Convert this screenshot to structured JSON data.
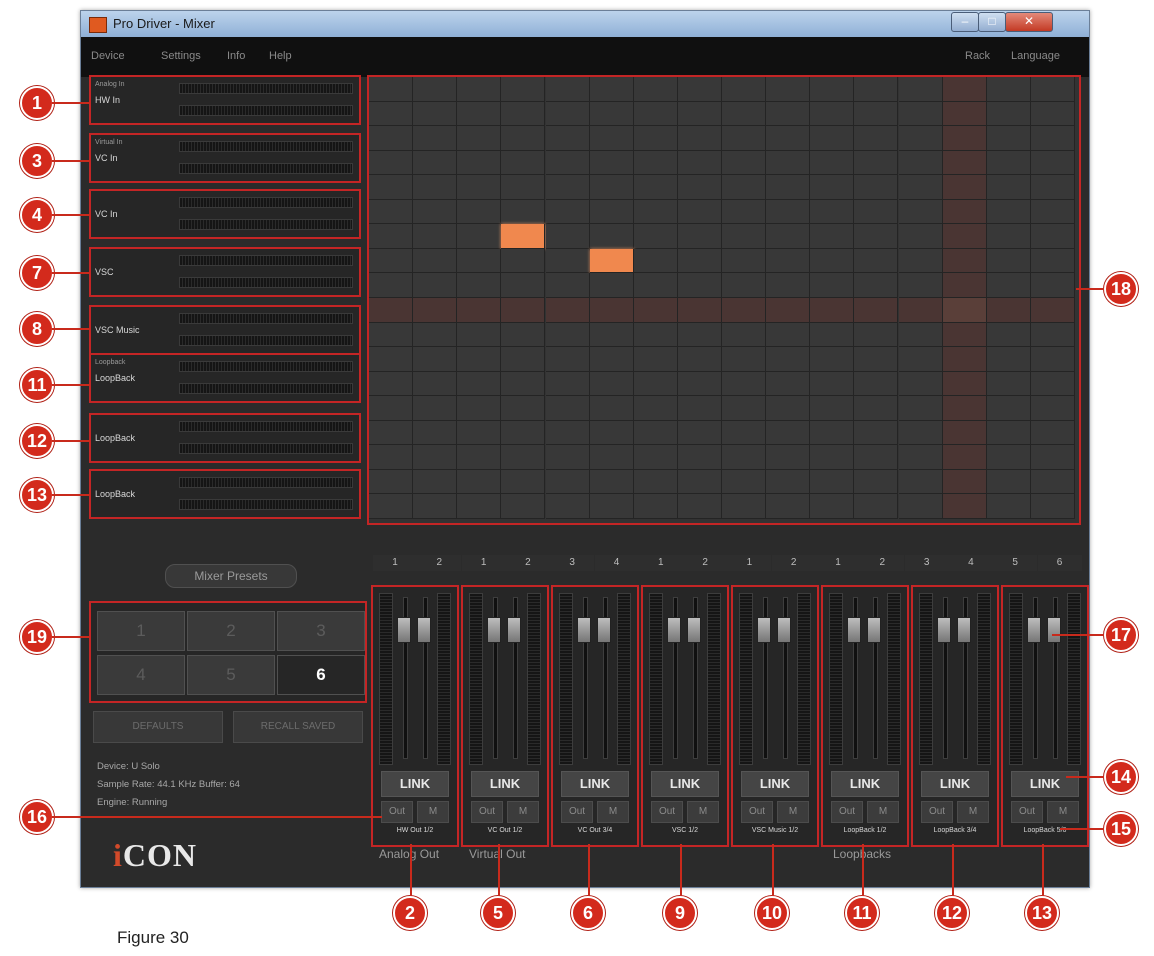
{
  "window": {
    "title": "Pro Driver - Mixer",
    "controls": {
      "minimize": "–",
      "maximize": "□",
      "close": "✕"
    }
  },
  "menu": {
    "left": [
      "Device",
      "Settings",
      "Info",
      "Help"
    ],
    "right": [
      "Rack",
      "Language"
    ]
  },
  "input_channels": [
    {
      "small": "Analog In",
      "name": "HW In"
    },
    {
      "small": "Virtual In",
      "name": "VC In"
    },
    {
      "small": "",
      "name": "VC In"
    },
    {
      "small": "",
      "name": "VSC"
    },
    {
      "small": "",
      "name": "VSC Music"
    },
    {
      "small": "Loopback",
      "name": "LoopBack"
    },
    {
      "small": "",
      "name": "LoopBack"
    },
    {
      "small": "",
      "name": "LoopBack"
    }
  ],
  "matrix": {
    "active_cells": [
      {
        "row": 6,
        "col": 3
      },
      {
        "row": 7,
        "col": 5
      }
    ],
    "highlight_row": 9,
    "highlight_col": 13
  },
  "output_headers": [
    "1",
    "2",
    "1",
    "2",
    "3",
    "4",
    "1",
    "2",
    "1",
    "2",
    "1",
    "2",
    "3",
    "4",
    "5",
    "6"
  ],
  "output_strips": [
    {
      "label": "HW Out 1/2"
    },
    {
      "label": "VC Out 1/2"
    },
    {
      "label": "VC Out 3/4"
    },
    {
      "label": "VSC 1/2"
    },
    {
      "label": "VSC Music 1/2"
    },
    {
      "label": "LoopBack 1/2"
    },
    {
      "label": "LoopBack 3/4"
    },
    {
      "label": "LoopBack 5/6"
    }
  ],
  "strip_controls": {
    "link": "LINK",
    "out": "Out",
    "mute": "M"
  },
  "presets": {
    "title": "Mixer Presets",
    "buttons": [
      "1",
      "2",
      "3",
      "4",
      "5",
      "6"
    ],
    "selected": "6",
    "defaults": "DEFAULTS",
    "recall": "RECALL SAVED"
  },
  "device_info": {
    "device": "Device: U Solo",
    "sample": "Sample Rate: 44.1 KHz   Buffer: 64",
    "engine": "Engine: Running"
  },
  "logo": {
    "first": "i",
    "rest": "CON"
  },
  "section_labels": [
    "Analog Out",
    "Virtual Out",
    "Loopbacks"
  ],
  "callouts": {
    "left": [
      "1",
      "3",
      "4",
      "7",
      "8",
      "11",
      "12",
      "13"
    ],
    "side": [
      "19",
      "16"
    ],
    "right": [
      "18",
      "17",
      "14",
      "15"
    ],
    "bottom": [
      "2",
      "5",
      "6",
      "9",
      "10",
      "11",
      "12",
      "13"
    ]
  },
  "figure_caption": "Figure 30",
  "colors": {
    "annotation_red": "#c42525",
    "active_cell": "#f0884e",
    "callout": "#d32a1c"
  }
}
